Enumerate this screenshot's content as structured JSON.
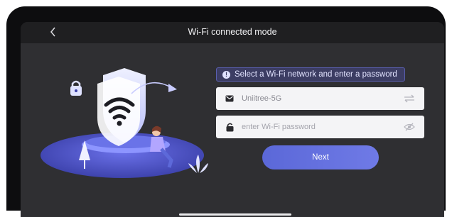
{
  "header": {
    "title": "Wi-Fi connected mode",
    "back_icon": "chevron-left-icon"
  },
  "hint": {
    "text": "Select a Wi-Fi network and enter a password",
    "icon": "info-icon"
  },
  "network_field": {
    "value": "Uniitree-5G",
    "icon": "wifi-network-icon",
    "action_icon": "switch-network-icon"
  },
  "password_field": {
    "placeholder": "enter Wi-Fi password",
    "icon": "lock-icon",
    "action_icon": "eye-hidden-icon"
  },
  "next_button": {
    "label": "Next"
  },
  "colors": {
    "accent": "#5b68d8",
    "background": "#2f2f32",
    "header": "#1f1f21"
  }
}
